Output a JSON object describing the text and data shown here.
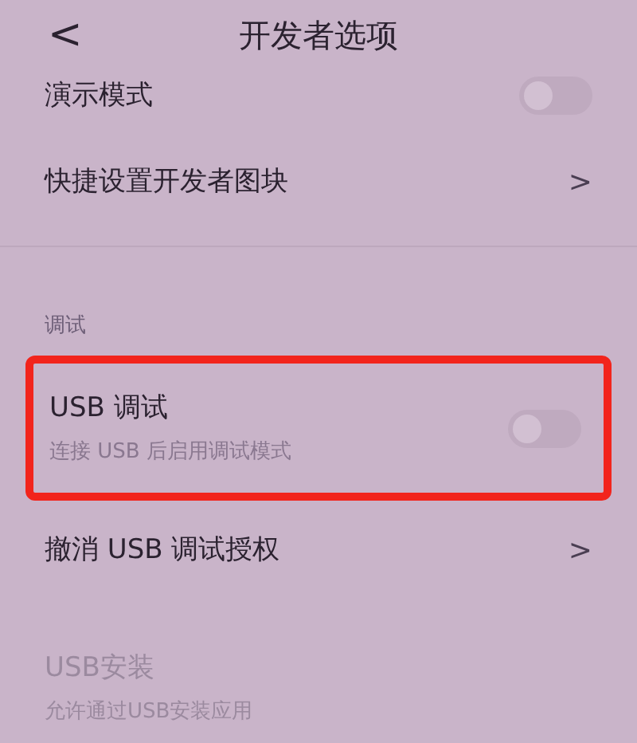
{
  "header": {
    "back": "<",
    "title": "开发者选项"
  },
  "items": [
    {
      "kind": "toggle",
      "title": "演示模式",
      "on": false,
      "disabled": false,
      "highlighted": false
    },
    {
      "kind": "link",
      "title": "快捷设置开发者图块",
      "chevron": ">",
      "disabled": false,
      "highlighted": false
    },
    {
      "kind": "section",
      "title": "调试"
    },
    {
      "kind": "toggle",
      "title": "USB 调试",
      "subtitle": "连接 USB 后启用调试模式",
      "on": false,
      "disabled": false,
      "highlighted": true
    },
    {
      "kind": "link",
      "title": "撤消 USB 调试授权",
      "chevron": ">",
      "disabled": false,
      "highlighted": false
    },
    {
      "kind": "plain",
      "title": "USB安装",
      "subtitle": "允许通过USB安装应用",
      "disabled": true,
      "highlighted": false
    }
  ]
}
